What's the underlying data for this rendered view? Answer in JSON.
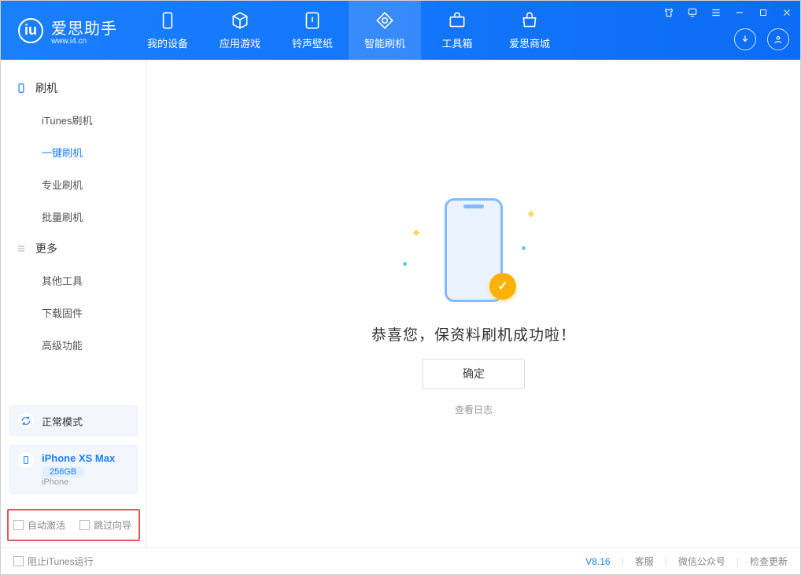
{
  "app": {
    "name_cn": "爱思助手",
    "name_en": "www.i4.cn"
  },
  "tabs": [
    {
      "label": "我的设备"
    },
    {
      "label": "应用游戏"
    },
    {
      "label": "铃声壁纸"
    },
    {
      "label": "智能刷机"
    },
    {
      "label": "工具箱"
    },
    {
      "label": "爱思商城"
    }
  ],
  "sidebar": {
    "group1": "刷机",
    "items1": [
      "iTunes刷机",
      "一键刷机",
      "专业刷机",
      "批量刷机"
    ],
    "group2": "更多",
    "items2": [
      "其他工具",
      "下载固件",
      "高级功能"
    ]
  },
  "device": {
    "mode": "正常模式",
    "name": "iPhone XS Max",
    "capacity": "256GB",
    "type": "iPhone"
  },
  "options": {
    "auto_activate": "自动激活",
    "skip_guide": "跳过向导"
  },
  "main": {
    "success": "恭喜您，保资料刷机成功啦！",
    "ok": "确定",
    "view_log": "查看日志"
  },
  "footer": {
    "stop_itunes": "阻止iTunes运行",
    "version": "V8.16",
    "support": "客服",
    "wechat": "微信公众号",
    "update": "检查更新"
  }
}
